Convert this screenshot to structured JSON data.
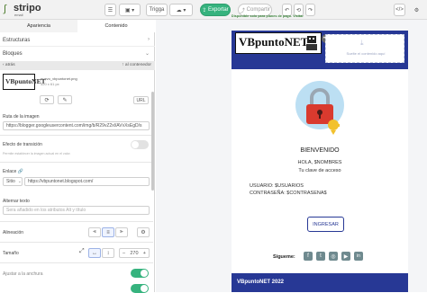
{
  "app": {
    "logo": "stripo",
    "logo_sub": "email"
  },
  "toolbar": {
    "trigger_label": "Trigga",
    "export_label": "Exportar",
    "share_label": "Compartir",
    "notice": "Disponible solo para planes de pago. Visitar"
  },
  "left_panel": {
    "tabs": [
      "Apariencia",
      "Contenido"
    ],
    "sections": {
      "estructuras": "Estructuras",
      "bloques": "Bloques"
    },
    "breadcrumb": {
      "back": "‹ atrás",
      "to_container": "al contenedor"
    },
    "image": {
      "brand": "VBpuntoNET",
      "filename": "nuevo_vbpuntonet.png",
      "size": "320 x 61 px",
      "url_btn": "URL"
    },
    "image_path_label": "Ruta de la imagen",
    "image_path_value": "https://blogger.googleusercontent.com/img/b/R29vZ2xl/AVvXsEgD/s",
    "transition_label": "Efecto de transición",
    "transition_hint": "Permite establecer la imagen actual en el valor.",
    "link_label": "Enlace",
    "link_type": "Sitio",
    "link_value": "https://vbpuntonet.blogspot.com/",
    "alt_label": "Alternar texto",
    "alt_placeholder": "Sera añadido en los atributos Alt y título",
    "align_label": "Alineación",
    "size_label": "Tamaño",
    "size_value": "270",
    "fit_label": "Ajustar a la anchura",
    "toggles": {
      "transition": false,
      "fit": true
    }
  },
  "email": {
    "brand": "VBpuntoNET",
    "drop_text": "Suelte el contenido aquí",
    "welcome": "BIENVENIDO",
    "greeting": "HOLA, $NOMBRES",
    "subtitle": "Tu clave de acceso",
    "user_line": "USUARIO: $USUARIOS",
    "pass_line": "CONTRASEÑA: $CONTRASENA$",
    "button": "INGRESAR",
    "follow_label": "Sigueme:",
    "footer": "VBpuntoNET 2022"
  },
  "colors": {
    "accent": "#36b37e",
    "email_blue": "#273895",
    "lock_red": "#d93a2e"
  }
}
